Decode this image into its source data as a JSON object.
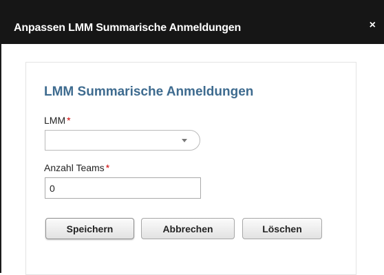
{
  "dialog": {
    "title": "Anpassen LMM Summarische Anmeldungen",
    "close_label": "×"
  },
  "form": {
    "heading": "LMM Summarische Anmeldungen",
    "required_marker": "*",
    "fields": {
      "lmm": {
        "label": "LMM",
        "value": ""
      },
      "teams": {
        "label": "Anzahl Teams",
        "value": "0"
      }
    },
    "buttons": {
      "save": "Speichern",
      "cancel": "Abbrechen",
      "delete": "Löschen"
    }
  },
  "colors": {
    "titlebar_bg": "#161616",
    "heading": "#3e6b8f",
    "required": "#cc0000"
  }
}
